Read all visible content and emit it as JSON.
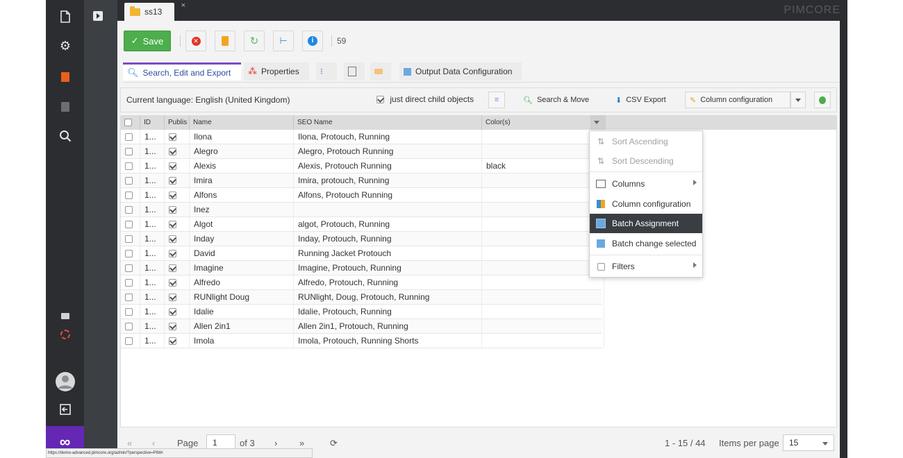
{
  "window": {
    "brand": "PIMCORE"
  },
  "doc_tab": {
    "title": "ss13",
    "close": "×"
  },
  "toolbar": {
    "save_label": "Save",
    "count": "59"
  },
  "tabs": [
    {
      "label": "Search, Edit and Export"
    },
    {
      "label": "Properties"
    },
    {
      "label": ""
    },
    {
      "label": ""
    },
    {
      "label": ""
    },
    {
      "label": "Output Data Configuration"
    }
  ],
  "gridbar": {
    "language": "Current language: English (United Kingdom)",
    "direct_children": "just direct child objects",
    "search_move": "Search & Move",
    "csv_export": "CSV Export",
    "column_config": "Column configuration"
  },
  "grid": {
    "headers": [
      "ID",
      "Publis",
      "Name",
      "SEO Name",
      "Color(s)"
    ],
    "rows": [
      {
        "id": "1...",
        "name": "Ilona",
        "seo": "Ilona, Protouch, Running",
        "color": ""
      },
      {
        "id": "1...",
        "name": "Alegro",
        "seo": "Alegro, Protouch Running",
        "color": ""
      },
      {
        "id": "1...",
        "name": "Alexis",
        "seo": "Alexis, Protouch Running",
        "color": "black"
      },
      {
        "id": "1...",
        "name": "Imira",
        "seo": "Imira, protouch, Running",
        "color": ""
      },
      {
        "id": "1...",
        "name": "Alfons",
        "seo": "Alfons, Protouch Running",
        "color": ""
      },
      {
        "id": "1...",
        "name": "Inez",
        "seo": "",
        "color": ""
      },
      {
        "id": "1...",
        "name": "Algot",
        "seo": "algot, Protouch, Running",
        "color": ""
      },
      {
        "id": "1...",
        "name": "Inday",
        "seo": "Inday, Protouch, Running",
        "color": ""
      },
      {
        "id": "1...",
        "name": "David",
        "seo": "Running Jacket Protouch",
        "color": ""
      },
      {
        "id": "1...",
        "name": "Imagine",
        "seo": "Imagine, Protouch, Running",
        "color": ""
      },
      {
        "id": "1...",
        "name": "Alfredo",
        "seo": "Alfredo, Protouch, Running",
        "color": ""
      },
      {
        "id": "1...",
        "name": "RUNlight Doug",
        "seo": "RUNlight, Doug, Protouch, Running",
        "color": ""
      },
      {
        "id": "1...",
        "name": "Idalie",
        "seo": "Idalie, Protouch, Running",
        "color": ""
      },
      {
        "id": "1...",
        "name": "Allen 2in1",
        "seo": "Allen 2in1, Protouch, Running",
        "color": ""
      },
      {
        "id": "1...",
        "name": "Imola",
        "seo": "Imola, Protouch, Running Shorts",
        "color": ""
      }
    ]
  },
  "menu": {
    "sort_asc": "Sort Ascending",
    "sort_desc": "Sort Descending",
    "columns": "Columns",
    "column_config": "Column configuration",
    "batch_assignment": "Batch Assignment",
    "batch_change_selected": "Batch change selected",
    "filters": "Filters"
  },
  "pager": {
    "page_label": "Page",
    "page_value": "1",
    "of": "of 3",
    "range": "1 - 15 / 44",
    "items_per_page": "Items per page",
    "per_page_value": "15"
  },
  "status_url": "https://demo-advanced.pimcore.org/admin/?perspective=PIM#",
  "colors": {
    "accent": "#7b4cc4",
    "save": "#4cae4c",
    "brand_purple": "#6428b4"
  }
}
